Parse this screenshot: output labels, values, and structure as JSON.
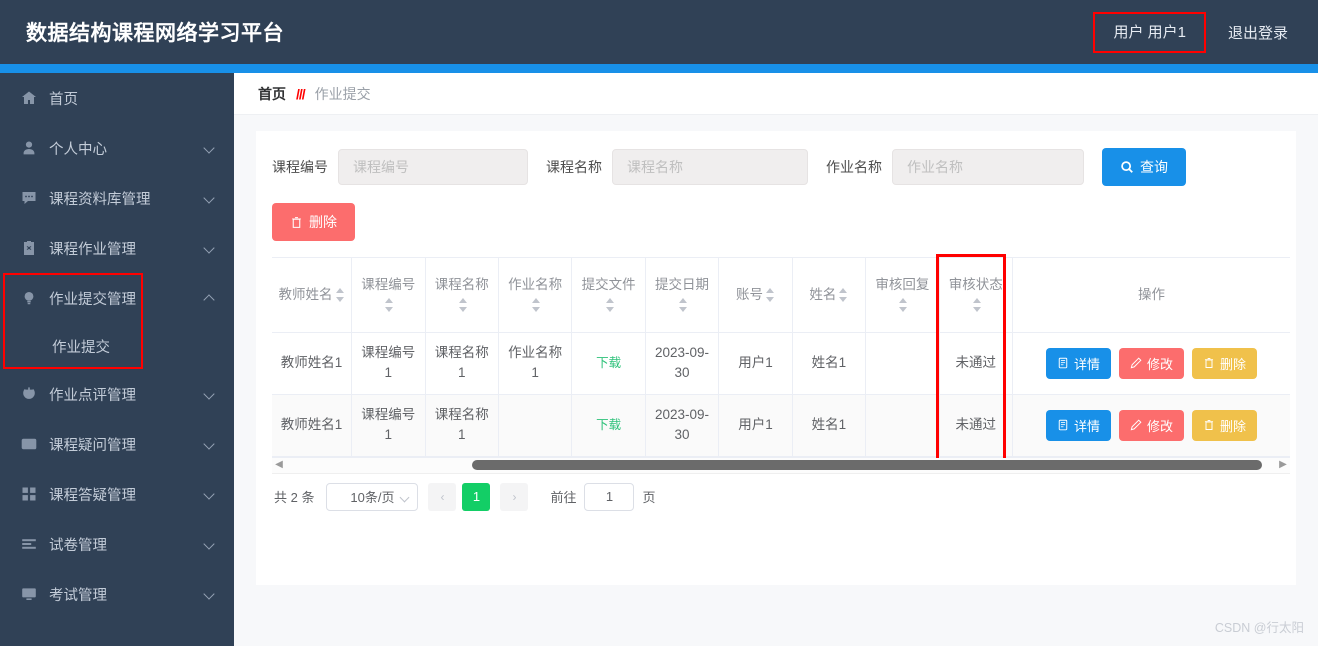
{
  "header": {
    "title": "数据结构课程网络学习平台",
    "user_label": "用户 用户1",
    "logout_label": "退出登录",
    "highlight_color": "#ff0000",
    "bg_color": "#304156",
    "accent_color": "#1890e8"
  },
  "sidebar": {
    "items": [
      {
        "label": "首页",
        "icon": "home-icon",
        "expandable": false
      },
      {
        "label": "个人中心",
        "icon": "user-icon",
        "expandable": true
      },
      {
        "label": "课程资料库管理",
        "icon": "message-icon",
        "expandable": true
      },
      {
        "label": "课程作业管理",
        "icon": "clipboard-icon",
        "expandable": true
      },
      {
        "label": "作业提交管理",
        "icon": "bulb-icon",
        "expandable": true,
        "expanded": true,
        "highlighted": true
      },
      {
        "label": "作业点评管理",
        "icon": "power-icon",
        "expandable": true
      },
      {
        "label": "课程疑问管理",
        "icon": "mail-icon",
        "expandable": true
      },
      {
        "label": "课程答疑管理",
        "icon": "grid-icon",
        "expandable": true
      },
      {
        "label": "试卷管理",
        "icon": "list-icon",
        "expandable": true
      },
      {
        "label": "考试管理",
        "icon": "monitor-icon",
        "expandable": true
      }
    ],
    "submenu": {
      "label": "作业提交"
    }
  },
  "breadcrumb": {
    "home": "首页",
    "separator": "///",
    "current": "作业提交"
  },
  "search": {
    "fields": [
      {
        "label": "课程编号",
        "placeholder": "课程编号",
        "value": ""
      },
      {
        "label": "课程名称",
        "placeholder": "课程名称",
        "value": ""
      },
      {
        "label": "作业名称",
        "placeholder": "作业名称",
        "value": ""
      }
    ],
    "query_button": "查询"
  },
  "toolbar": {
    "delete_label": "删除"
  },
  "table": {
    "columns": [
      {
        "label": "教师姓名",
        "sortable": true
      },
      {
        "label": "课程编号",
        "sortable": true
      },
      {
        "label": "课程名称",
        "sortable": true
      },
      {
        "label": "作业名称",
        "sortable": true
      },
      {
        "label": "提交文件",
        "sortable": true
      },
      {
        "label": "提交日期",
        "sortable": true
      },
      {
        "label": "账号",
        "sortable": true
      },
      {
        "label": "姓名",
        "sortable": true
      },
      {
        "label": "审核回复",
        "sortable": true
      },
      {
        "label": "审核状态",
        "sortable": true,
        "highlighted": true
      },
      {
        "label": "操作",
        "sortable": false
      }
    ],
    "rows": [
      {
        "teacher": "教师姓名1",
        "course_no": "课程编号1",
        "course_name": "课程名称1",
        "homework_name": "作业名称1",
        "file": "下载",
        "date": "2023-09-30",
        "account": "用户1",
        "name": "姓名1",
        "reply": "",
        "status": "未通过"
      },
      {
        "teacher": "教师姓名1",
        "course_no": "课程编号1",
        "course_name": "课程名称1",
        "homework_name": "",
        "file": "下载",
        "date": "2023-09-30",
        "account": "用户1",
        "name": "姓名1",
        "reply": "",
        "status": "未通过"
      }
    ],
    "ops": {
      "detail": "详情",
      "edit": "修改",
      "delete": "删除"
    }
  },
  "pagination": {
    "total_text": "共 2 条",
    "page_size": "10条/页",
    "prev": "‹",
    "next": "›",
    "current_page": "1",
    "jump_prefix": "前往",
    "jump_value": "1",
    "jump_suffix": "页"
  },
  "watermark": "CSDN @行太阳"
}
